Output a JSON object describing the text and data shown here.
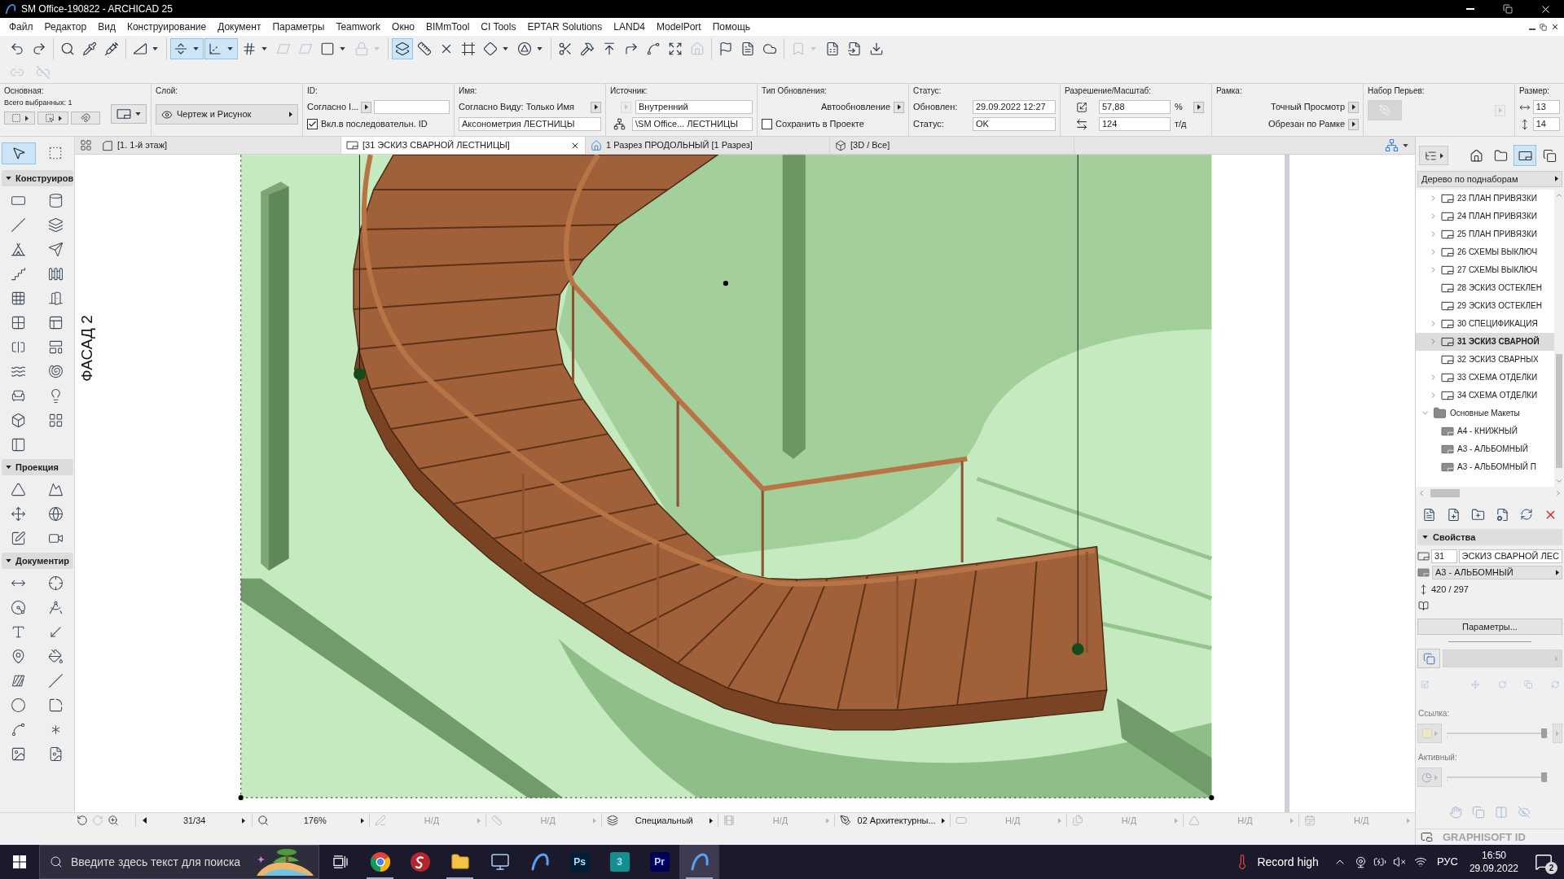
{
  "title_bar": {
    "title": "SM Office-190822 - ARCHICAD 25"
  },
  "menu": [
    "Файл",
    "Редактор",
    "Вид",
    "Конструирование",
    "Документ",
    "Параметры",
    "Teamwork",
    "Окно",
    "BIMmTool",
    "CI Tools",
    "EPTAR Solutions",
    "LAND4",
    "ModelPort",
    "Помощь"
  ],
  "toolbar": {
    "row_1": [
      [
        {
          "on": false,
          "dropdown": false,
          "disabled": false
        },
        {
          "on": false,
          "dropdown": false,
          "disabled": false
        }
      ],
      [
        {
          "on": false,
          "dropdown": false,
          "disabled": false
        },
        {
          "on": false,
          "dropdown": false,
          "disabled": false
        },
        {
          "on": false,
          "dropdown": false,
          "disabled": false
        }
      ],
      [
        {
          "on": false,
          "dropdown": true,
          "disabled": false
        }
      ],
      [
        {
          "on": true,
          "dropdown": true,
          "disabled": false
        },
        {
          "on": true,
          "dropdown": true,
          "disabled": false
        },
        {
          "on": false,
          "dropdown": true,
          "disabled": false
        },
        {
          "on": false,
          "dropdown": false,
          "disabled": true
        },
        {
          "on": false,
          "dropdown": false,
          "disabled": true
        },
        {
          "on": false,
          "dropdown": true,
          "disabled": false
        },
        {
          "on": false,
          "dropdown": true,
          "disabled": true
        }
      ],
      [
        {
          "on": true,
          "dropdown": false,
          "disabled": false
        },
        {
          "on": false,
          "dropdown": false,
          "disabled": false
        },
        {
          "on": false,
          "dropdown": false,
          "disabled": false
        },
        {
          "on": false,
          "dropdown": false,
          "disabled": false
        },
        {
          "on": false,
          "dropdown": true,
          "disabled": false
        },
        {
          "on": false,
          "dropdown": true,
          "disabled": false
        }
      ],
      [
        {
          "on": false,
          "dropdown": false,
          "disabled": false
        },
        {
          "on": false,
          "dropdown": false,
          "disabled": false
        },
        {
          "on": false,
          "dropdown": false,
          "disabled": false
        },
        {
          "on": false,
          "dropdown": false,
          "disabled": false
        },
        {
          "on": false,
          "dropdown": false,
          "disabled": false
        },
        {
          "on": false,
          "dropdown": false,
          "disabled": false
        },
        {
          "on": false,
          "dropdown": false,
          "disabled": true
        }
      ],
      [
        {
          "on": false,
          "dropdown": false,
          "disabled": false
        },
        {
          "on": false,
          "dropdown": false,
          "disabled": false
        },
        {
          "on": false,
          "dropdown": false,
          "disabled": false
        }
      ],
      [
        {
          "on": false,
          "dropdown": true,
          "disabled": true
        },
        {
          "on": false,
          "dropdown": false,
          "disabled": false
        },
        {
          "on": false,
          "dropdown": false,
          "disabled": false
        },
        {
          "on": false,
          "dropdown": false,
          "disabled": false
        }
      ]
    ],
    "row_2": [
      {
        "on": false,
        "dropdown": false,
        "disabled": true
      },
      {
        "on": false,
        "dropdown": false,
        "disabled": true
      }
    ]
  },
  "info_box": [
    {
      "kind": "selection",
      "title": "Основная:",
      "text": "Всего выбранных: 1"
    },
    {
      "kind": "layer",
      "title": "Слой:",
      "value": "Чертеж и Рисунок"
    },
    {
      "kind": "id",
      "title": "ID:",
      "mode": "Согласно I...",
      "checkbox": {
        "label": "Вкл.в последовательн. ID",
        "checked": true
      }
    },
    {
      "kind": "name",
      "title": "Имя:",
      "mode": "Согласно Виду: Только Имя",
      "value": "Аксонометрия ЛЕСТНИЦЫ"
    },
    {
      "kind": "source",
      "title": "Источник:",
      "button_disabled": true,
      "value": "Внутренний",
      "path": "\\SM Office... ЛЕСТНИЦЫ"
    },
    {
      "kind": "update",
      "title": "Тип Обновления:",
      "mode": "Автообновление",
      "checkbox": {
        "label": "Сохранить в Проекте",
        "checked": false
      }
    },
    {
      "kind": "status",
      "title": "Статус:",
      "rows": [
        {
          "label": "Обновлен:",
          "value": "29.09.2022 12:27"
        },
        {
          "label": "Статус:",
          "value": "OK"
        }
      ]
    },
    {
      "kind": "scale",
      "title": "Разрешение/Масштаб:",
      "percent": "57,88",
      "percent_unit": "%",
      "dpi": "124",
      "dpi_unit": "т/д"
    },
    {
      "kind": "frame",
      "title": "Рамка:",
      "options": [
        "Точный Просмотр",
        "Обрезан по Рамке"
      ]
    },
    {
      "kind": "pens",
      "title": "Набор Перьев:",
      "disabled": true
    },
    {
      "kind": "size",
      "title": "Размер:",
      "values": [
        "13",
        "14"
      ]
    }
  ],
  "toolbox": {
    "top": [
      {
        "selected": true
      },
      {
        "selected": false
      }
    ],
    "sections": [
      {
        "title": "Конструиров",
        "expanded": true,
        "tools": [
          {
            "selected": false
          },
          {
            "selected": false
          },
          {
            "selected": false
          },
          {
            "selected": false
          },
          {
            "selected": false
          },
          {
            "selected": false
          },
          {
            "selected": false
          },
          {
            "selected": false
          },
          {
            "selected": false
          },
          {
            "selected": false
          },
          {
            "selected": false
          },
          {
            "selected": false
          },
          {
            "selected": false
          },
          {
            "selected": false
          },
          {
            "selected": false
          },
          {
            "selected": false
          },
          {
            "selected": false
          },
          {
            "selected": false
          },
          {
            "selected": false
          },
          {
            "selected": false
          },
          {
            "selected": false
          }
        ]
      },
      {
        "title": "Проекция",
        "expanded": true,
        "tools": [
          {
            "selected": false
          },
          {
            "selected": false
          },
          {
            "selected": false
          },
          {
            "selected": false
          },
          {
            "selected": false
          },
          {
            "selected": false
          }
        ]
      },
      {
        "title": "Документир",
        "expanded": true,
        "tools": [
          {
            "selected": false
          },
          {
            "selected": false
          },
          {
            "selected": false
          },
          {
            "selected": false
          },
          {
            "selected": false
          },
          {
            "selected": false
          },
          {
            "selected": false
          },
          {
            "selected": false
          },
          {
            "selected": false
          },
          {
            "selected": false
          },
          {
            "selected": false
          },
          {
            "selected": false
          },
          {
            "selected": false
          },
          {
            "selected": false
          },
          {
            "selected": false
          },
          {
            "selected": false
          }
        ]
      }
    ]
  },
  "tabs": [
    {
      "label": "[1. 1-й этаж]",
      "kind": "plan",
      "selected": false
    },
    {
      "label": "[31 ЭСКИЗ СВАРНОЙ ЛЕСТНИЦЫ]",
      "kind": "layout",
      "selected": true
    },
    {
      "label": "1 Разрез ПРОДОЛЬНЫЙ [1 Разрез]",
      "kind": "section",
      "selected": false
    },
    {
      "label": "[3D / Все]",
      "kind": "model",
      "selected": false
    }
  ],
  "canvas": {
    "side_label": "ФАСАД 2"
  },
  "status_bar": {
    "page": "31/34",
    "zoom": "176%",
    "fields": [
      {
        "text": "Н/Д",
        "disabled": true
      },
      {
        "text": "Н/Д",
        "disabled": true
      },
      {
        "text": "Специальный",
        "disabled": false
      },
      {
        "text": "Н/Д",
        "disabled": true
      },
      {
        "text": "02 Архитектурны...",
        "disabled": false
      },
      {
        "text": "Н/Д",
        "disabled": true
      },
      {
        "text": "Н/Д",
        "disabled": true
      },
      {
        "text": "Н/Д",
        "disabled": true
      },
      {
        "text": "Н/Д",
        "disabled": true
      }
    ]
  },
  "navigator": {
    "modes": [
      {
        "selected": false
      },
      {
        "selected": false
      },
      {
        "selected": true
      },
      {
        "selected": false
      }
    ],
    "view": "Дерево по поднаборам",
    "tree": [
      {
        "children": [
          {
            "label": "23 ПЛАН ПРИВЯЗКИ",
            "kind": "layout",
            "expandable": true,
            "expanded": false,
            "selected": false
          },
          {
            "label": "24 ПЛАН ПРИВЯЗКИ",
            "kind": "layout",
            "expandable": true,
            "expanded": false,
            "selected": false
          },
          {
            "label": "25 ПЛАН ПРИВЯЗКИ",
            "kind": "layout",
            "expandable": true,
            "expanded": false,
            "selected": false
          },
          {
            "label": "26 СХЕМЫ ВЫКЛЮЧ",
            "kind": "layout",
            "expandable": true,
            "expanded": false,
            "selected": false
          },
          {
            "label": "27 СХЕМЫ ВЫКЛЮЧ",
            "kind": "layout",
            "expandable": true,
            "expanded": false,
            "selected": false
          },
          {
            "label": "28 ЭСКИЗ ОСТЕКЛЕН",
            "kind": "layout",
            "expandable": false,
            "selected": false
          },
          {
            "label": "29 ЭСКИЗ ОСТЕКЛЕН",
            "kind": "layout",
            "expandable": false,
            "selected": false
          },
          {
            "label": "30 СПЕЦИФИКАЦИЯ",
            "kind": "layout",
            "expandable": true,
            "expanded": false,
            "selected": false
          },
          {
            "label": "31 ЭСКИЗ СВАРНОЙ",
            "kind": "layout",
            "expandable": true,
            "expanded": false,
            "selected": true
          },
          {
            "label": "32 ЭСКИЗ СВАРНЫХ",
            "kind": "layout",
            "expandable": false,
            "selected": false
          },
          {
            "label": "33 СХЕМА ОТДЕЛКИ",
            "kind": "layout",
            "expandable": true,
            "expanded": false,
            "selected": false
          },
          {
            "label": "34 СХЕМА ОТДЕЛКИ",
            "kind": "layout",
            "expandable": true,
            "expanded": false,
            "selected": false
          }
        ]
      },
      {
        "label": "Основные Макеты",
        "kind": "folder",
        "expandable": true,
        "expanded": true,
        "selected": false,
        "children": [
          {
            "label": "А4 - КНИЖНЫЙ",
            "kind": "master",
            "expandable": false,
            "selected": false
          },
          {
            "label": "А3 - АЛЬБОМНЫЙ",
            "kind": "master",
            "expandable": false,
            "selected": false
          },
          {
            "label": "А3 - АЛЬБОМНЫЙ П",
            "kind": "master",
            "expandable": false,
            "selected": false
          }
        ]
      }
    ],
    "properties": {
      "title": "Свойства",
      "expanded": true,
      "number": "31",
      "name": "ЭСКИЗ СВАРНОЙ ЛЕС",
      "master": "А3 - АЛЬБОМНЫЙ",
      "size": "420 / 297",
      "settings_button": "Параметры..."
    },
    "transform": {
      "dropdown_disabled": true
    },
    "sliders": [
      {
        "kind": "swatch",
        "label": "Ссылка:",
        "level": 0.97
      },
      {
        "kind": "pie",
        "label": "Активный:",
        "level": 0.97
      }
    ],
    "footer": "GRAPHISOFT ID"
  },
  "taskbar": {
    "search": {
      "placeholder": "Введите здесь текст для поиска"
    },
    "apps": [
      {
        "kind": "icon",
        "running": true,
        "active": false
      },
      {
        "kind": "icon",
        "running": false,
        "active": false
      },
      {
        "kind": "icon",
        "running": true,
        "active": false
      },
      {
        "kind": "icon",
        "running": false,
        "active": false
      },
      {
        "kind": "icon",
        "running": false,
        "active": false
      },
      {
        "kind": "tile",
        "label": "Ps",
        "color": "#001e36",
        "running": false,
        "active": false
      },
      {
        "kind": "tile",
        "label": "3",
        "color": "#138f8f",
        "running": false,
        "active": false
      },
      {
        "kind": "tile",
        "label": "Pr",
        "color": "#00005b",
        "running": false,
        "active": false
      },
      {
        "kind": "icon",
        "running": true,
        "active": true
      }
    ],
    "weather": "Record high",
    "language": "РУС",
    "time": "16:50",
    "date": "29.09.2022",
    "notifications": "2"
  }
}
